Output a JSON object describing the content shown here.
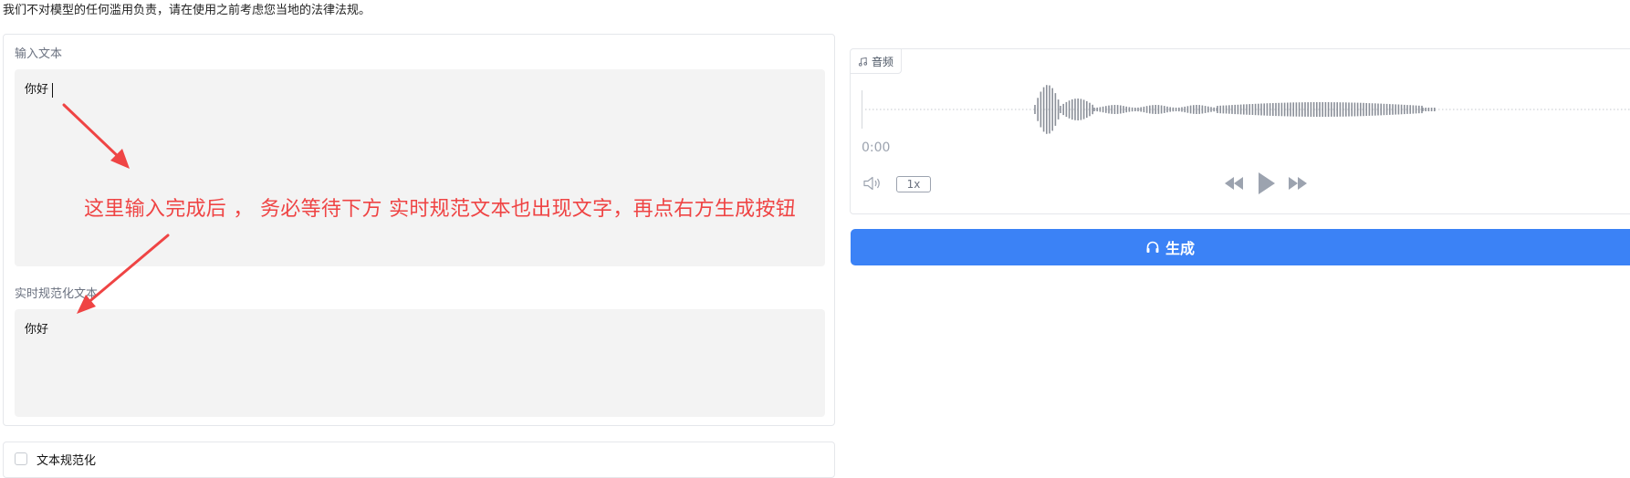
{
  "disclaimer": "我们不对模型的任何滥用负责，请在使用之前考虑您当地的法律法规。",
  "input_section": {
    "label": "输入文本",
    "value": "你好"
  },
  "normalized_section": {
    "label": "实时规范化文本",
    "value": "你好"
  },
  "checkbox": {
    "label": "文本规范化",
    "checked": false
  },
  "audio": {
    "tab_label": "音频",
    "time": "0:00",
    "speed": "1x"
  },
  "generate": {
    "label": "生成"
  },
  "annotation": {
    "text": "这里输入完成后 ， 务必等待下方 实时规范文本也出现文字，再点右方生成按钮",
    "color": "#ef4444"
  },
  "colors": {
    "accent": "#3b82f6"
  }
}
